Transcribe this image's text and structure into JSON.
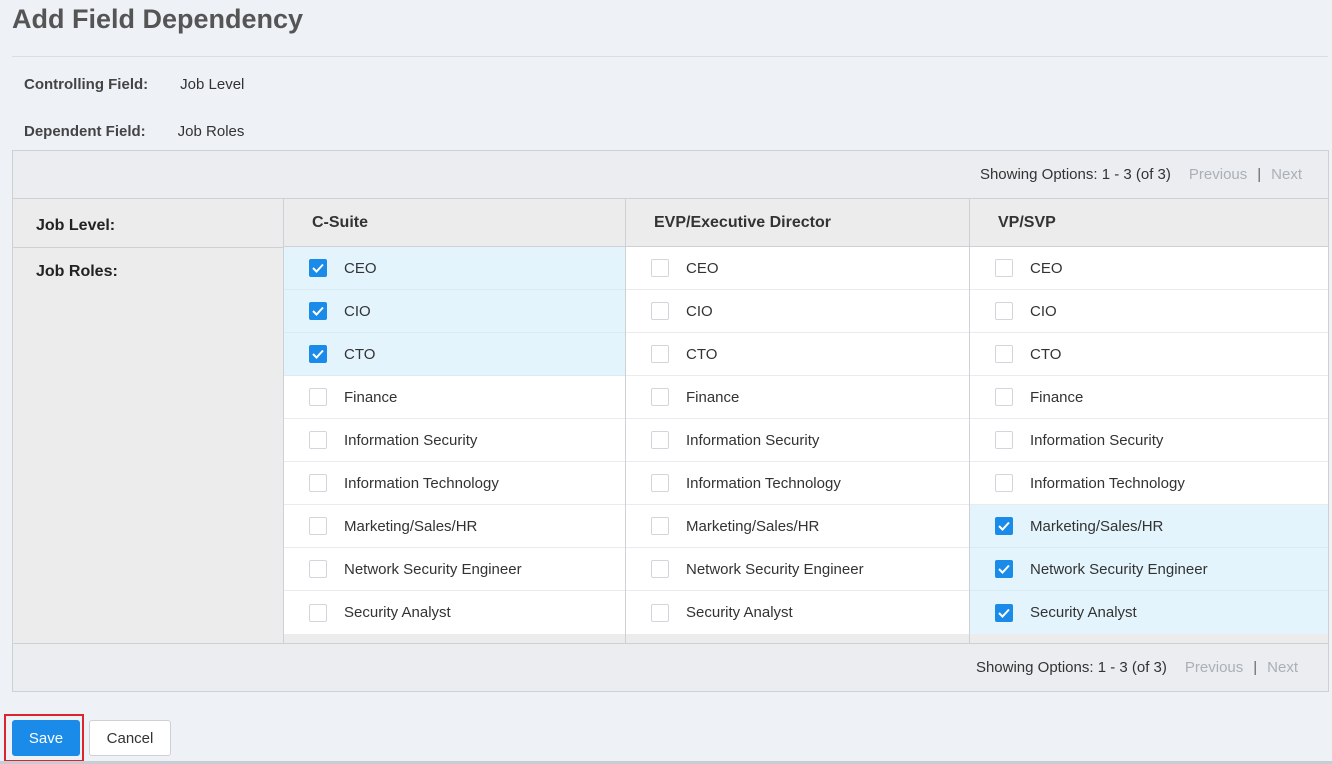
{
  "page": {
    "title": "Add Field Dependency"
  },
  "fields": {
    "controlling_label": "Controlling Field:",
    "controlling_value": "Job Level",
    "dependent_label": "Dependent Field:",
    "dependent_value": "Job Roles"
  },
  "pager": {
    "info": "Showing Options: 1 - 3 (of 3)",
    "previous": "Previous",
    "separator": "|",
    "next": "Next"
  },
  "grid": {
    "row_label_level": "Job Level:",
    "row_label_roles": "Job Roles:",
    "columns": [
      {
        "header": "C-Suite",
        "options": [
          {
            "label": "CEO",
            "checked": true
          },
          {
            "label": "CIO",
            "checked": true
          },
          {
            "label": "CTO",
            "checked": true
          },
          {
            "label": "Finance",
            "checked": false
          },
          {
            "label": "Information Security",
            "checked": false
          },
          {
            "label": "Information Technology",
            "checked": false
          },
          {
            "label": "Marketing/Sales/HR",
            "checked": false
          },
          {
            "label": "Network Security Engineer",
            "checked": false
          },
          {
            "label": "Security Analyst",
            "checked": false
          }
        ]
      },
      {
        "header": "EVP/Executive Director",
        "options": [
          {
            "label": "CEO",
            "checked": false
          },
          {
            "label": "CIO",
            "checked": false
          },
          {
            "label": "CTO",
            "checked": false
          },
          {
            "label": "Finance",
            "checked": false
          },
          {
            "label": "Information Security",
            "checked": false
          },
          {
            "label": "Information Technology",
            "checked": false
          },
          {
            "label": "Marketing/Sales/HR",
            "checked": false
          },
          {
            "label": "Network Security Engineer",
            "checked": false
          },
          {
            "label": "Security Analyst",
            "checked": false
          }
        ]
      },
      {
        "header": "VP/SVP",
        "options": [
          {
            "label": "CEO",
            "checked": false
          },
          {
            "label": "CIO",
            "checked": false
          },
          {
            "label": "CTO",
            "checked": false
          },
          {
            "label": "Finance",
            "checked": false
          },
          {
            "label": "Information Security",
            "checked": false
          },
          {
            "label": "Information Technology",
            "checked": false
          },
          {
            "label": "Marketing/Sales/HR",
            "checked": true
          },
          {
            "label": "Network Security Engineer",
            "checked": true
          },
          {
            "label": "Security Analyst",
            "checked": true
          }
        ]
      }
    ]
  },
  "actions": {
    "save": "Save",
    "cancel": "Cancel"
  },
  "colors": {
    "accent": "#1a8be8",
    "highlight": "#d9262e",
    "checked_row": "#e3f4fc"
  }
}
